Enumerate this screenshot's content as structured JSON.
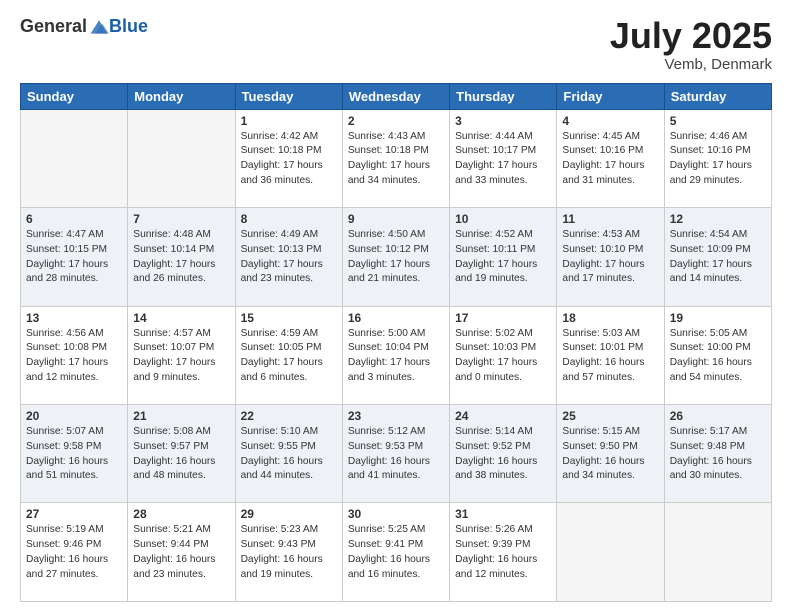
{
  "header": {
    "logo_general": "General",
    "logo_blue": "Blue",
    "month": "July 2025",
    "location": "Vemb, Denmark"
  },
  "days": [
    "Sunday",
    "Monday",
    "Tuesday",
    "Wednesday",
    "Thursday",
    "Friday",
    "Saturday"
  ],
  "weeks": [
    [
      {
        "day": "",
        "sunrise": "",
        "sunset": "",
        "daylight": ""
      },
      {
        "day": "",
        "sunrise": "",
        "sunset": "",
        "daylight": ""
      },
      {
        "day": "1",
        "sunrise": "Sunrise: 4:42 AM",
        "sunset": "Sunset: 10:18 PM",
        "daylight": "Daylight: 17 hours and 36 minutes."
      },
      {
        "day": "2",
        "sunrise": "Sunrise: 4:43 AM",
        "sunset": "Sunset: 10:18 PM",
        "daylight": "Daylight: 17 hours and 34 minutes."
      },
      {
        "day": "3",
        "sunrise": "Sunrise: 4:44 AM",
        "sunset": "Sunset: 10:17 PM",
        "daylight": "Daylight: 17 hours and 33 minutes."
      },
      {
        "day": "4",
        "sunrise": "Sunrise: 4:45 AM",
        "sunset": "Sunset: 10:16 PM",
        "daylight": "Daylight: 17 hours and 31 minutes."
      },
      {
        "day": "5",
        "sunrise": "Sunrise: 4:46 AM",
        "sunset": "Sunset: 10:16 PM",
        "daylight": "Daylight: 17 hours and 29 minutes."
      }
    ],
    [
      {
        "day": "6",
        "sunrise": "Sunrise: 4:47 AM",
        "sunset": "Sunset: 10:15 PM",
        "daylight": "Daylight: 17 hours and 28 minutes."
      },
      {
        "day": "7",
        "sunrise": "Sunrise: 4:48 AM",
        "sunset": "Sunset: 10:14 PM",
        "daylight": "Daylight: 17 hours and 26 minutes."
      },
      {
        "day": "8",
        "sunrise": "Sunrise: 4:49 AM",
        "sunset": "Sunset: 10:13 PM",
        "daylight": "Daylight: 17 hours and 23 minutes."
      },
      {
        "day": "9",
        "sunrise": "Sunrise: 4:50 AM",
        "sunset": "Sunset: 10:12 PM",
        "daylight": "Daylight: 17 hours and 21 minutes."
      },
      {
        "day": "10",
        "sunrise": "Sunrise: 4:52 AM",
        "sunset": "Sunset: 10:11 PM",
        "daylight": "Daylight: 17 hours and 19 minutes."
      },
      {
        "day": "11",
        "sunrise": "Sunrise: 4:53 AM",
        "sunset": "Sunset: 10:10 PM",
        "daylight": "Daylight: 17 hours and 17 minutes."
      },
      {
        "day": "12",
        "sunrise": "Sunrise: 4:54 AM",
        "sunset": "Sunset: 10:09 PM",
        "daylight": "Daylight: 17 hours and 14 minutes."
      }
    ],
    [
      {
        "day": "13",
        "sunrise": "Sunrise: 4:56 AM",
        "sunset": "Sunset: 10:08 PM",
        "daylight": "Daylight: 17 hours and 12 minutes."
      },
      {
        "day": "14",
        "sunrise": "Sunrise: 4:57 AM",
        "sunset": "Sunset: 10:07 PM",
        "daylight": "Daylight: 17 hours and 9 minutes."
      },
      {
        "day": "15",
        "sunrise": "Sunrise: 4:59 AM",
        "sunset": "Sunset: 10:05 PM",
        "daylight": "Daylight: 17 hours and 6 minutes."
      },
      {
        "day": "16",
        "sunrise": "Sunrise: 5:00 AM",
        "sunset": "Sunset: 10:04 PM",
        "daylight": "Daylight: 17 hours and 3 minutes."
      },
      {
        "day": "17",
        "sunrise": "Sunrise: 5:02 AM",
        "sunset": "Sunset: 10:03 PM",
        "daylight": "Daylight: 17 hours and 0 minutes."
      },
      {
        "day": "18",
        "sunrise": "Sunrise: 5:03 AM",
        "sunset": "Sunset: 10:01 PM",
        "daylight": "Daylight: 16 hours and 57 minutes."
      },
      {
        "day": "19",
        "sunrise": "Sunrise: 5:05 AM",
        "sunset": "Sunset: 10:00 PM",
        "daylight": "Daylight: 16 hours and 54 minutes."
      }
    ],
    [
      {
        "day": "20",
        "sunrise": "Sunrise: 5:07 AM",
        "sunset": "Sunset: 9:58 PM",
        "daylight": "Daylight: 16 hours and 51 minutes."
      },
      {
        "day": "21",
        "sunrise": "Sunrise: 5:08 AM",
        "sunset": "Sunset: 9:57 PM",
        "daylight": "Daylight: 16 hours and 48 minutes."
      },
      {
        "day": "22",
        "sunrise": "Sunrise: 5:10 AM",
        "sunset": "Sunset: 9:55 PM",
        "daylight": "Daylight: 16 hours and 44 minutes."
      },
      {
        "day": "23",
        "sunrise": "Sunrise: 5:12 AM",
        "sunset": "Sunset: 9:53 PM",
        "daylight": "Daylight: 16 hours and 41 minutes."
      },
      {
        "day": "24",
        "sunrise": "Sunrise: 5:14 AM",
        "sunset": "Sunset: 9:52 PM",
        "daylight": "Daylight: 16 hours and 38 minutes."
      },
      {
        "day": "25",
        "sunrise": "Sunrise: 5:15 AM",
        "sunset": "Sunset: 9:50 PM",
        "daylight": "Daylight: 16 hours and 34 minutes."
      },
      {
        "day": "26",
        "sunrise": "Sunrise: 5:17 AM",
        "sunset": "Sunset: 9:48 PM",
        "daylight": "Daylight: 16 hours and 30 minutes."
      }
    ],
    [
      {
        "day": "27",
        "sunrise": "Sunrise: 5:19 AM",
        "sunset": "Sunset: 9:46 PM",
        "daylight": "Daylight: 16 hours and 27 minutes."
      },
      {
        "day": "28",
        "sunrise": "Sunrise: 5:21 AM",
        "sunset": "Sunset: 9:44 PM",
        "daylight": "Daylight: 16 hours and 23 minutes."
      },
      {
        "day": "29",
        "sunrise": "Sunrise: 5:23 AM",
        "sunset": "Sunset: 9:43 PM",
        "daylight": "Daylight: 16 hours and 19 minutes."
      },
      {
        "day": "30",
        "sunrise": "Sunrise: 5:25 AM",
        "sunset": "Sunset: 9:41 PM",
        "daylight": "Daylight: 16 hours and 16 minutes."
      },
      {
        "day": "31",
        "sunrise": "Sunrise: 5:26 AM",
        "sunset": "Sunset: 9:39 PM",
        "daylight": "Daylight: 16 hours and 12 minutes."
      },
      {
        "day": "",
        "sunrise": "",
        "sunset": "",
        "daylight": ""
      },
      {
        "day": "",
        "sunrise": "",
        "sunset": "",
        "daylight": ""
      }
    ]
  ]
}
